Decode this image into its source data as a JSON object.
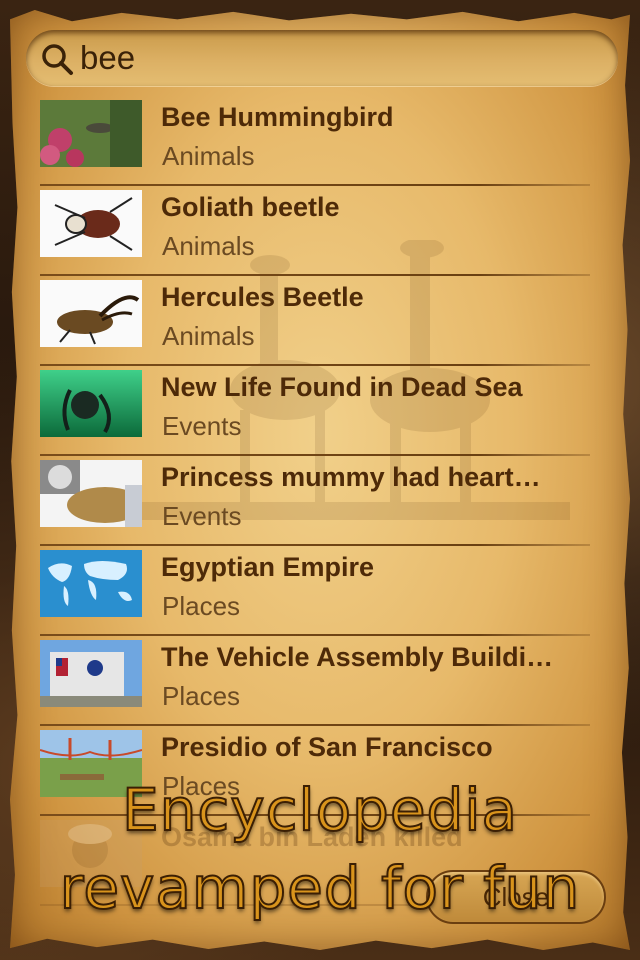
{
  "search": {
    "value": "bee",
    "icon": "search-icon"
  },
  "results": [
    {
      "title": "Bee Hummingbird",
      "category": "Animals",
      "thumb": "hummingbird-photo"
    },
    {
      "title": "Goliath beetle",
      "category": "Animals",
      "thumb": "goliath-beetle-photo"
    },
    {
      "title": "Hercules Beetle",
      "category": "Animals",
      "thumb": "hercules-beetle-photo"
    },
    {
      "title": "New Life Found in Dead Sea",
      "category": "Events",
      "thumb": "underwater-diver-photo"
    },
    {
      "title": "Princess mummy had heart…",
      "category": "Events",
      "thumb": "mummy-photo"
    },
    {
      "title": "Egyptian Empire",
      "category": "Places",
      "thumb": "world-map-image"
    },
    {
      "title": "The Vehicle Assembly Buildi…",
      "category": "Places",
      "thumb": "vehicle-assembly-building-photo"
    },
    {
      "title": "Presidio of San Francisco",
      "category": "Places",
      "thumb": "presidio-photo"
    },
    {
      "title": "Osama bin Laden killed",
      "category": "",
      "thumb": "portrait-photo"
    }
  ],
  "close_button": {
    "label": "Close"
  },
  "promo": {
    "line1": "Encyclopedia",
    "line2": "revamped for fun"
  },
  "colors": {
    "parchment": "#e7b96a",
    "title_text": "#4e2a08",
    "category_text": "#6b4a22",
    "promo_text": "#d9941c"
  }
}
